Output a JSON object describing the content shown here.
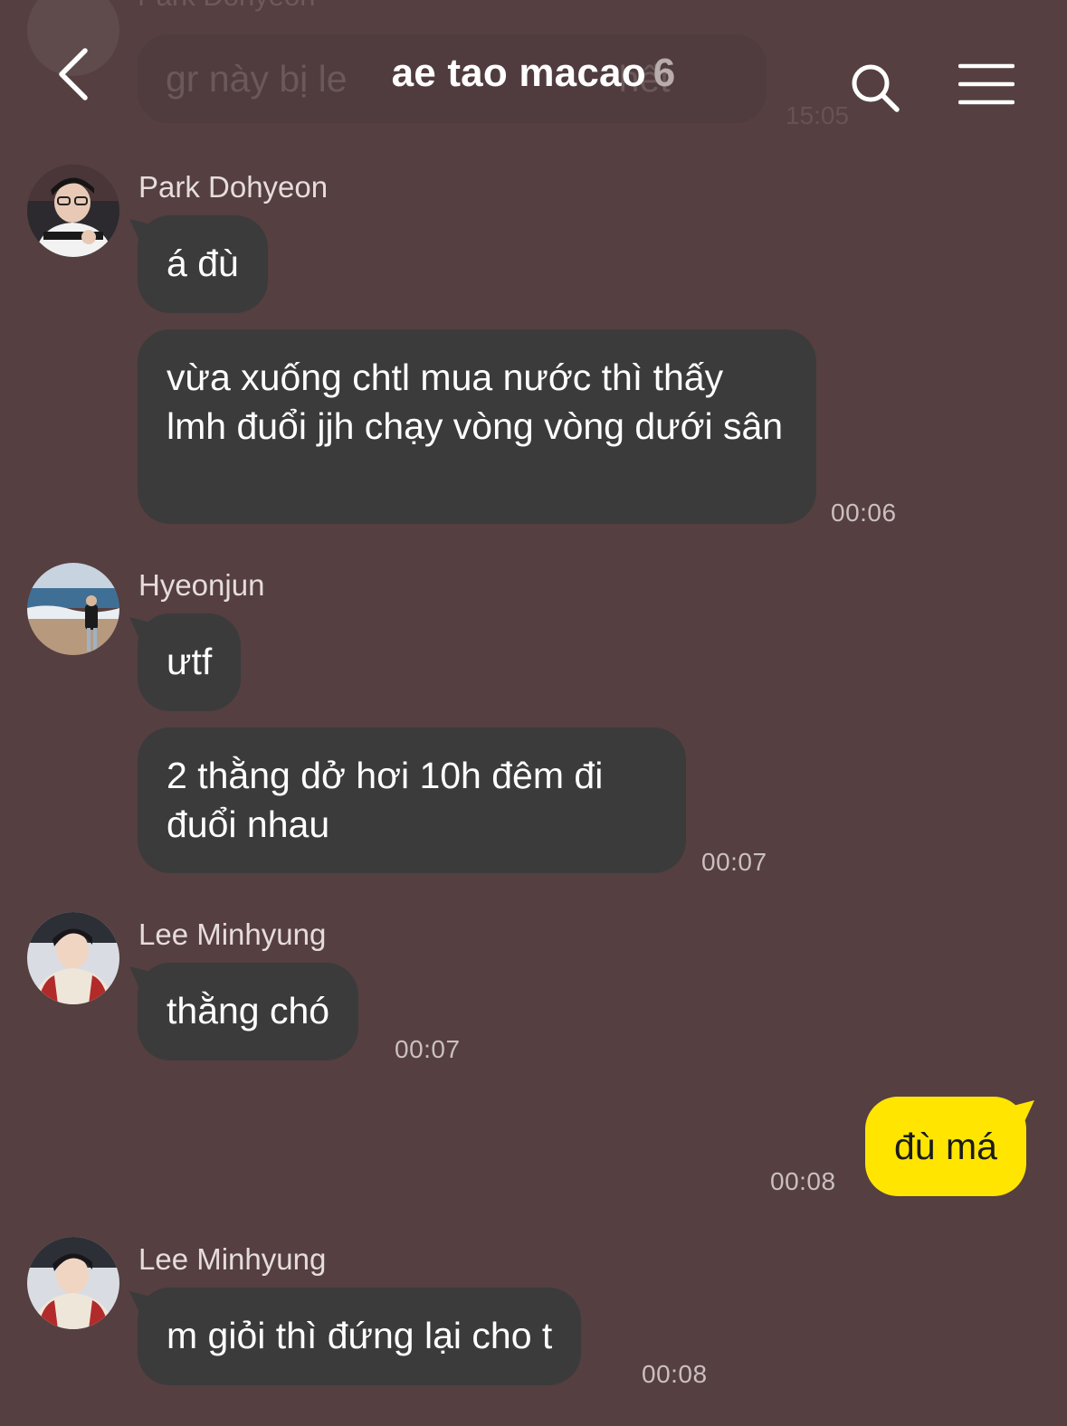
{
  "header": {
    "title": "ae tao macao",
    "member_count": "6"
  },
  "ghost": {
    "sender": "Park Dohyeon",
    "text": "gr này bị le",
    "text_tail": "hết",
    "time": "15:05"
  },
  "messages": [
    {
      "sender": "Park Dohyeon",
      "avatar": "Park Dohyeon avatar",
      "bubbles": [
        "á đù",
        "vừa xuống chtl mua nước thì thấy lmh đuổi jjh chạy vòng vòng dưới sân"
      ],
      "time": "00:06"
    },
    {
      "sender": "Hyeonjun",
      "avatar": "Hyeonjun avatar",
      "bubbles": [
        "ưtf",
        "2 thằng dở hơi 10h đêm đi đuổi nhau"
      ],
      "time": "00:07"
    },
    {
      "sender": "Lee Minhyung",
      "avatar": "Lee Minhyung avatar",
      "bubbles": [
        "thằng chó"
      ],
      "time": "00:07"
    },
    {
      "sender": "me",
      "bubbles": [
        "đù má"
      ],
      "time": "00:08"
    },
    {
      "sender": "Lee Minhyung",
      "avatar": "Lee Minhyung avatar",
      "bubbles": [
        "m giỏi thì đứng lại cho t"
      ],
      "time": "00:08"
    }
  ],
  "icons": {
    "back": "chevron-left-icon",
    "search": "search-icon",
    "menu": "hamburger-menu-icon"
  },
  "colors": {
    "background": "#553f40",
    "bubble_other": "#3b3b3c",
    "bubble_mine": "#ffe500",
    "text_primary": "#ffffff",
    "timestamp": "#cbbfbf"
  }
}
